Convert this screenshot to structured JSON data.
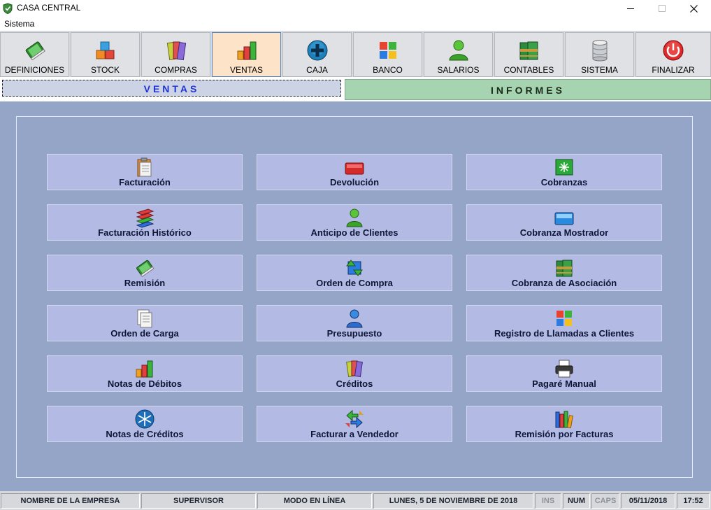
{
  "window": {
    "title": "CASA CENTRAL"
  },
  "menu": {
    "items": [
      "Sistema"
    ]
  },
  "toolbar": {
    "active": "VENTAS",
    "items": [
      {
        "label": "DEFINICIONES",
        "icon": "book-icon"
      },
      {
        "label": "STOCK",
        "icon": "cubes-icon"
      },
      {
        "label": "COMPRAS",
        "icon": "binders-icon"
      },
      {
        "label": "VENTAS",
        "icon": "bar-chart-icon"
      },
      {
        "label": "CAJA",
        "icon": "plus-circle-icon"
      },
      {
        "label": "BANCO",
        "icon": "windows-flag-icon"
      },
      {
        "label": "SALARIOS",
        "icon": "user-icon"
      },
      {
        "label": "CONTABLES",
        "icon": "ledger-books-icon"
      },
      {
        "label": "SISTEMA",
        "icon": "database-icon"
      },
      {
        "label": "FINALIZAR",
        "icon": "power-icon"
      }
    ]
  },
  "sections": {
    "ventas": "VENTAS",
    "informes": "INFORMES"
  },
  "functions": [
    {
      "label": "Facturación",
      "icon": "clipboard-icon"
    },
    {
      "label": "Devolución",
      "icon": "red-card-icon"
    },
    {
      "label": "Cobranzas",
      "icon": "green-star-icon"
    },
    {
      "label": "Facturación Histórico",
      "icon": "stacked-layers-icon"
    },
    {
      "label": "Anticipo de Clientes",
      "icon": "user-green-icon"
    },
    {
      "label": "Cobranza Mostrador",
      "icon": "blue-card-icon"
    },
    {
      "label": "Remisión",
      "icon": "book-icon"
    },
    {
      "label": "Orden de Compra",
      "icon": "sync-arrows-icon"
    },
    {
      "label": "Cobranza de Asociación",
      "icon": "ledger-books-icon"
    },
    {
      "label": "Orden de Carga",
      "icon": "documents-icon"
    },
    {
      "label": "Presupuesto",
      "icon": "user-blue-icon"
    },
    {
      "label": "Registro de Llamadas a Clientes",
      "icon": "windows-flag-icon"
    },
    {
      "label": "Notas de Débitos",
      "icon": "bar-chart-icon"
    },
    {
      "label": "Créditos",
      "icon": "binders-icon"
    },
    {
      "label": "Pagaré Manual",
      "icon": "printer-icon"
    },
    {
      "label": "Notas de Créditos",
      "icon": "snowflake-icon"
    },
    {
      "label": "Facturar a Vendedor",
      "icon": "recycle-arrows-icon"
    },
    {
      "label": "Remisión por Facturas",
      "icon": "books-icon"
    }
  ],
  "status": {
    "company": "NOMBRE DE LA EMPRESA",
    "user": "SUPERVISOR",
    "mode": "MODO EN LÍNEA",
    "date_long": "LUNES, 5 DE NOVIEMBRE DE 2018",
    "ins": "INS",
    "num": "NUM",
    "caps": "CAPS",
    "date": "05/11/2018",
    "time": "17:52"
  }
}
